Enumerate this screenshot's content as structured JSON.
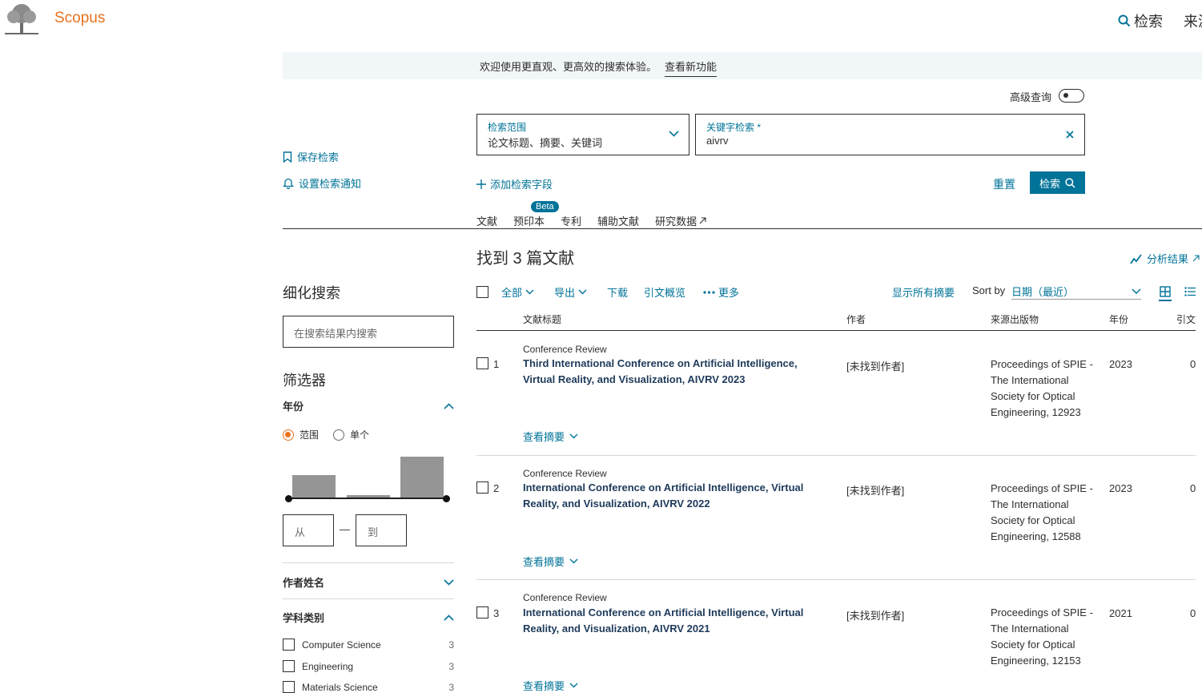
{
  "header": {
    "brand": "Scopus",
    "nav_search": "检索",
    "nav_sources": "来源"
  },
  "banner": {
    "text": "欢迎使用更直观、更高效的搜索体验。",
    "link": "查看新功能"
  },
  "advanced": {
    "label": "高级查询",
    "enabled": false
  },
  "side_actions": {
    "save_search": "保存检索",
    "set_alert": "设置检索通知"
  },
  "search_form": {
    "scope_label": "检索范围",
    "scope_value": "论文标题、摘要、关键词",
    "keyword_label": "关键字检索 *",
    "keyword_value": "aivrv",
    "add_field": "添加检索字段",
    "reset": "重置",
    "search": "检索"
  },
  "tabs": {
    "items": [
      {
        "label": "文献"
      },
      {
        "label": "预印本",
        "badge": "Beta"
      },
      {
        "label": "专利"
      },
      {
        "label": "辅助文献"
      },
      {
        "label": "研究数据"
      }
    ]
  },
  "results": {
    "found": "找到 3 篇文献",
    "analyze": "分析结果"
  },
  "refine": {
    "title": "细化搜索",
    "within_placeholder": "在搜索结果内搜索",
    "filters_title": "筛选器",
    "year": {
      "title": "年份",
      "mode_range": "范围",
      "mode_single": "单个",
      "selected_mode": "范围",
      "histogram": [
        1,
        0,
        1
      ],
      "from_placeholder": "从",
      "to_placeholder": "到",
      "separator": "—"
    },
    "author": {
      "title": "作者姓名"
    },
    "subject": {
      "title": "学科类别",
      "items": [
        {
          "name": "Computer Science",
          "count": "3"
        },
        {
          "name": "Engineering",
          "count": "3"
        },
        {
          "name": "Materials Science",
          "count": "3"
        }
      ]
    }
  },
  "toolbar": {
    "all": "全部",
    "export": "导出",
    "download": "下载",
    "citation_overview": "引文概览",
    "more": "更多",
    "show_abstracts": "显示所有摘要",
    "sort_by": "Sort by",
    "sort_value": "日期（最近）"
  },
  "table": {
    "col_title": "文献标题",
    "col_authors": "作者",
    "col_source": "来源出版物",
    "col_year": "年份",
    "col_cited": "引文",
    "view_abstract": "查看摘要",
    "rows": [
      {
        "num": "1",
        "type": "Conference Review",
        "title": "Third International Conference on Artificial Intelligence, Virtual Reality, and Visualization, AIVRV 2023",
        "authors": "[未找到作者]",
        "source": "Proceedings of SPIE - The International Society for Optical Engineering, 12923",
        "year": "2023",
        "cited": "0"
      },
      {
        "num": "2",
        "type": "Conference Review",
        "title": "International Conference on Artificial Intelligence, Virtual Reality, and Visualization, AIVRV 2022",
        "authors": "[未找到作者]",
        "source": "Proceedings of SPIE - The International Society for Optical Engineering, 12588",
        "year": "2023",
        "cited": "0"
      },
      {
        "num": "3",
        "type": "Conference Review",
        "title": "International Conference on Artificial Intelligence, Virtual Reality, and Visualization, AIVRV 2021",
        "authors": "[未找到作者]",
        "source": "Proceedings of SPIE - The International Society for Optical Engineering, 12153",
        "year": "2021",
        "cited": "0"
      }
    ]
  },
  "colors": {
    "accent": "#007398",
    "brand": "#e9711c",
    "text": "#2e2e2e"
  }
}
